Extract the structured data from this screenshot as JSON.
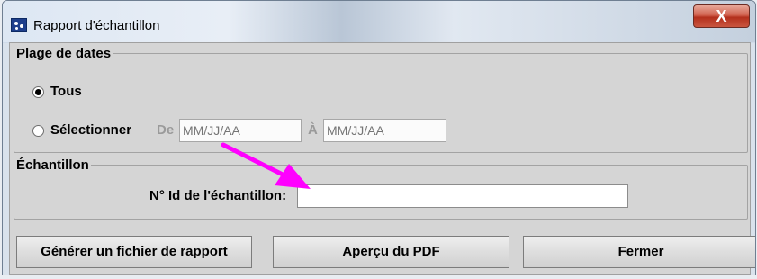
{
  "window": {
    "title": "Rapport d'échantillon",
    "close_label": "X"
  },
  "date_range": {
    "legend": "Plage de dates",
    "option_all": "Tous",
    "option_select": "Sélectionner",
    "selected": "Tous",
    "from_label": "De",
    "from_placeholder": "MM/JJ/AA",
    "to_label": "À",
    "to_placeholder": "MM/JJ/AA"
  },
  "sample": {
    "legend": "Échantillon",
    "id_label": "N° Id de l'échantillon:",
    "id_value": ""
  },
  "buttons": {
    "generate": "Générer un fichier de rapport",
    "preview": "Aperçu du PDF",
    "close": "Fermer"
  },
  "annotation": {
    "arrow_color": "#ff00ff"
  }
}
